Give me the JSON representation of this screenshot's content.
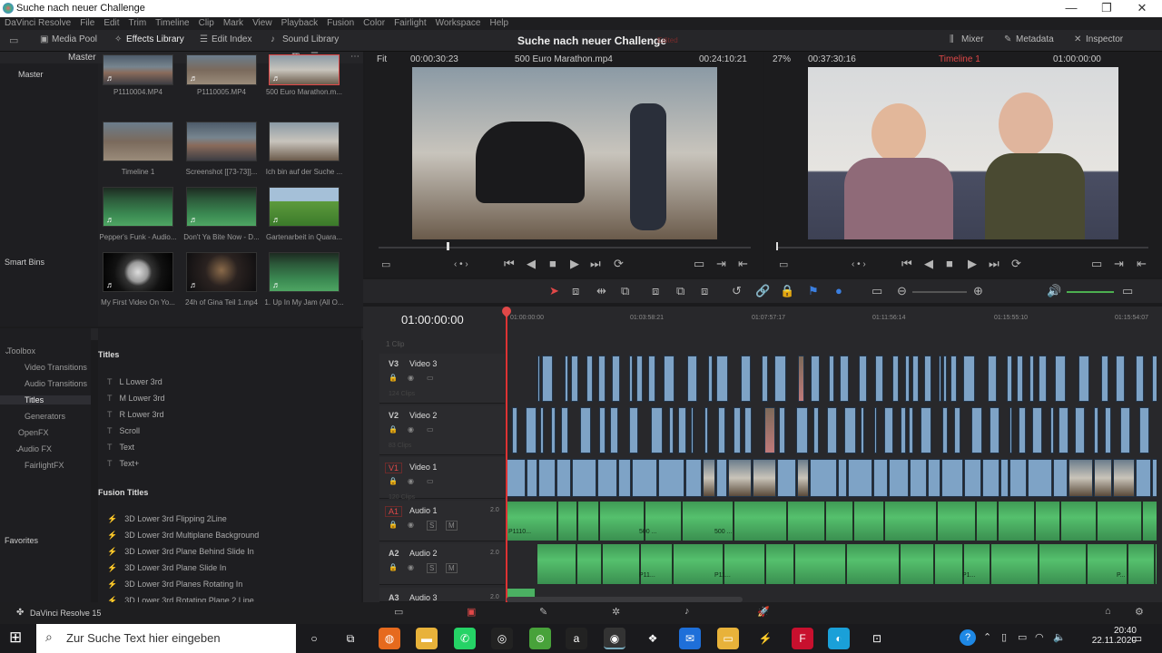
{
  "window": {
    "title": "Suche nach neuer Challenge",
    "min": "—",
    "max": "❐",
    "close": "✕"
  },
  "menu": [
    "DaVinci Resolve",
    "File",
    "Edit",
    "Trim",
    "Timeline",
    "Clip",
    "Mark",
    "View",
    "Playback",
    "Fusion",
    "Color",
    "Fairlight",
    "Workspace",
    "Help"
  ],
  "toolbar": {
    "media_pool": "Media Pool",
    "effects_library": "Effects Library",
    "edit_index": "Edit Index",
    "sound_library": "Sound Library",
    "project_title": "Suche nach neuer Challenge",
    "edited": "Edited",
    "mixer": "Mixer",
    "metadata": "Metadata",
    "inspector": "Inspector"
  },
  "viewer": {
    "fit": "Fit",
    "src_tc": "00:00:30:23",
    "clip_name": "500 Euro Marathon.mp4",
    "src_tc2": "00:24:10:21",
    "zoom": "27%",
    "dur": "00:37:30:16",
    "timeline_name": "Timeline 1",
    "rec_tc": "01:00:00:00"
  },
  "pool": {
    "master": "Master",
    "smart_bins": "Smart Bins",
    "favorites": "Favorites",
    "clips": [
      {
        "name": "P1110004.MP4",
        "kind": "scene1"
      },
      {
        "name": "P1110005.MP4",
        "kind": "scene2"
      },
      {
        "name": "500 Euro Marathon.m...",
        "kind": "scene3",
        "selected": true
      },
      {
        "name": "Timeline 1",
        "kind": "scene2"
      },
      {
        "name": "Screenshot [[73-73]]...",
        "kind": "scene1"
      },
      {
        "name": "Ich bin auf der Suche ...",
        "kind": "scene3"
      },
      {
        "name": "Pepper's Funk - Audio...",
        "kind": "audio"
      },
      {
        "name": "Don't Ya Bite Now - D...",
        "kind": "audio"
      },
      {
        "name": "Gartenarbeit in Quara...",
        "kind": "grass"
      },
      {
        "name": "My First Video On Yo...",
        "kind": "wheel"
      },
      {
        "name": "24h of Gina Teil 1.mp4",
        "kind": "dark"
      },
      {
        "name": "1. Up In My Jam (All O...",
        "kind": "audio"
      }
    ]
  },
  "toolbox": {
    "tree": [
      "Toolbox",
      "Video Transitions",
      "Audio Transitions",
      "Titles",
      "Generators",
      "OpenFX",
      "Audio FX",
      "FairlightFX"
    ],
    "titles_header": "Titles",
    "titles": [
      "L Lower 3rd",
      "M Lower 3rd",
      "R Lower 3rd",
      "Scroll",
      "Text",
      "Text+"
    ],
    "fusion_header": "Fusion Titles",
    "fusion": [
      "3D Lower 3rd Flipping 2Line",
      "3D Lower 3rd Multiplane Background",
      "3D Lower 3rd Plane Behind Slide In",
      "3D Lower 3rd Plane Slide In",
      "3D Lower 3rd Planes Rotating In",
      "3D Lower 3rd Rotating Plane 2 Line"
    ]
  },
  "timeline": {
    "timecode": "01:00:00:00",
    "ruler": [
      "01:00:00:00",
      "01:03:58:21",
      "01:07:57:17",
      "01:11:56:14",
      "01:15:55:10",
      "01:15:54:07"
    ],
    "tracks": [
      {
        "id": "V3",
        "name": "Video 3",
        "sub": "124 Clips"
      },
      {
        "id": "V2",
        "name": "Video 2",
        "sub": "83 Clips"
      },
      {
        "id": "V1",
        "name": "Video 1",
        "sub": "120 Clips"
      },
      {
        "id": "A1",
        "name": "Audio 1",
        "level": "2.0",
        "clip_label": "P1110...",
        "clip_label2": "500 ...",
        "clip_label3": "500 ..."
      },
      {
        "id": "A2",
        "name": "Audio 2",
        "level": "2.0",
        "clip_label": "P11...",
        "clip_label2": "P11...",
        "clip_label3": "P1...",
        "clip_label4": "P..."
      },
      {
        "id": "A3",
        "name": "Audio 3",
        "level": "2.0"
      }
    ],
    "top_sub": "1 Clip"
  },
  "status": {
    "app": "DaVinci Resolve 15"
  },
  "taskbar": {
    "search_placeholder": "Zur Suche Text hier eingeben",
    "time": "20:40",
    "date": "22.11.2020"
  }
}
